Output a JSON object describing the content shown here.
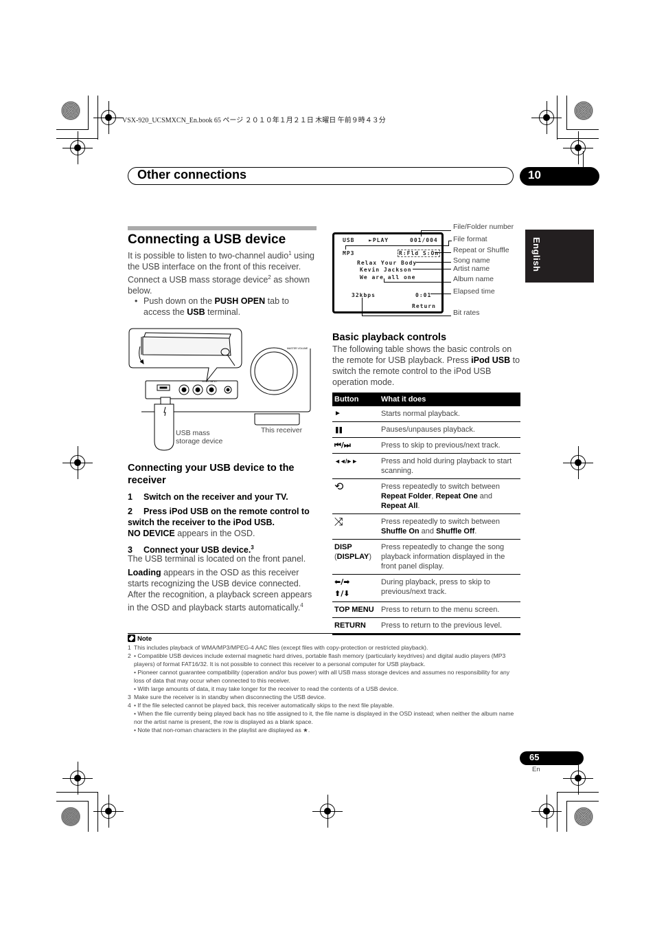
{
  "print_header": {
    "book_line": "VSX-920_UCSMXCN_En.book   65 ページ   ２０１０年１月２１日   木曜日   午前９時４３分"
  },
  "header": {
    "title": "Other connections",
    "chapter_number": "10"
  },
  "language_tab": "English",
  "section": {
    "title": "Connecting a USB device",
    "intro": {
      "part1": "It is possible to listen to two-channel audio",
      "sup1": "1",
      "part2": " using the USB interface on the front of this receiver. Connect a USB mass storage device",
      "sup2": "2",
      "part3": " as shown below."
    },
    "bullet": {
      "dot": "•",
      "pre": "Push down on the ",
      "bold1": "PUSH OPEN",
      "mid": " tab to access the ",
      "bold2": "USB",
      "post": " terminal."
    },
    "illustration": {
      "usb_label_line1": "USB mass",
      "usb_label_line2": "storage device",
      "receiver_label": "This receiver",
      "master_volume_label": "MASTER VOLUME",
      "panel_label": "VIDEO INPUT"
    }
  },
  "subsection": {
    "title": "Connecting your USB device to the receiver",
    "steps": [
      {
        "num": "1",
        "text": "Switch on the receiver and your TV."
      },
      {
        "num": "2",
        "text": "Press iPod USB on the remote control to switch the receiver to the iPod USB."
      },
      {
        "num": "3",
        "text": "Connect your USB device.",
        "sup": "3"
      }
    ],
    "step2_result_bold": "NO DEVICE",
    "step2_result_rest": " appears in the OSD.",
    "step3_detail": "The USB terminal is located on the front panel.",
    "loading_bold": "Loading",
    "loading_rest": " appears in the OSD as this receiver starts recognizing the USB device connected. After the recognition, a playback screen appears in the OSD and playback starts automatically.",
    "loading_sup": "4"
  },
  "osd": {
    "source": "USB",
    "status": "►PLAY",
    "file_number": "001/004",
    "format": "MP3",
    "repeat_shuffle": "R:Fld S:On",
    "song": "Relax Your Body",
    "artist": "Kevin Jackson",
    "album": "We are all one",
    "bitrate": "32kbps",
    "elapsed": "0:01",
    "return": "Return",
    "callouts": {
      "file_folder_number": "File/Folder number",
      "file_format": "File format",
      "repeat_or_shuffle": "Repeat or Shuffle",
      "song_name": "Song name",
      "artist_name": "Artist name",
      "album_name": "Album name",
      "elapsed_time": "Elapsed time",
      "bit_rates": "Bit rates"
    }
  },
  "playback": {
    "title": "Basic playback controls",
    "intro_pre": "The following table shows the basic controls on the remote for USB playback. Press ",
    "intro_bold": "iPod USB",
    "intro_post": " to switch the remote control to the iPod USB operation mode.",
    "table": {
      "headers": [
        "Button",
        "What it does"
      ],
      "rows": [
        {
          "button": "►",
          "icon": "play-icon",
          "desc": "Starts normal playback."
        },
        {
          "button": "❚❚",
          "icon": "pause-icon",
          "desc": "Pauses/unpauses playback."
        },
        {
          "button": "⏮/⏭",
          "icon": "skip-icon",
          "desc": "Press to skip to previous/next track."
        },
        {
          "button": "◄◄/►►",
          "icon": "scan-icon",
          "desc": "Press and hold during playback to start scanning."
        },
        {
          "button": "⟲",
          "icon": "repeat-icon",
          "desc_pre": "Press repeatedly to switch between ",
          "b1": "Repeat Folder",
          "s1": ", ",
          "b2": "Repeat One",
          "s2": " and ",
          "b3": "Repeat All",
          "s3": "."
        },
        {
          "button": "⤨",
          "icon": "shuffle-icon",
          "desc_pre": "Press repeatedly to switch between ",
          "b1": "Shuffle On",
          "s1": " and ",
          "b2": "Shuffle Off",
          "s2": "."
        },
        {
          "button": "DISP",
          "button_sub_open": "(",
          "button_sub": "DISPLAY",
          "button_sub_close": ")",
          "desc": "Press repeatedly to change the song playback information displayed in the front panel display."
        },
        {
          "button": "⬅/➡",
          "button2": "⬆/⬇",
          "icon": "arrow-icon",
          "desc": "During playback, press to skip to previous/next track."
        },
        {
          "button": "TOP MENU",
          "desc": "Press to return to the menu screen."
        },
        {
          "button": "RETURN",
          "desc": "Press to return to the previous level."
        }
      ]
    }
  },
  "notes": {
    "title": "Note",
    "items": [
      {
        "num": "1",
        "lines": [
          "This includes playback of WMA/MP3/MPEG-4 AAC files (except files with copy-protection or restricted playback)."
        ]
      },
      {
        "num": "2",
        "lines": [
          "• Compatible USB devices include external magnetic hard drives, portable flash memory (particularly keydrives) and digital audio players (MP3 players) of format FAT16/32. It is not possible to connect this receiver to a personal computer for USB playback.",
          "• Pioneer cannot guarantee compatibility (operation and/or bus power) with all USB mass storage devices and assumes no responsibility for any loss of data that may occur when connected to this receiver.",
          "• With large amounts of data, it may take longer for the receiver to read the contents of a USB device."
        ]
      },
      {
        "num": "3",
        "lines": [
          "Make sure the receiver is in standby when disconnecting the USB device."
        ]
      },
      {
        "num": "4",
        "lines": [
          "• If the file selected cannot be played back, this receiver automatically skips to the next file playable.",
          "• When the file currently being played back has no title assigned to it, the file name is displayed in the OSD instead; when neither the album name nor the artist name is present, the row is displayed as a blank space.",
          "• Note that non-roman characters in the playlist are displayed as ★."
        ]
      }
    ]
  },
  "footer": {
    "page_number": "65",
    "page_lang": "En"
  }
}
